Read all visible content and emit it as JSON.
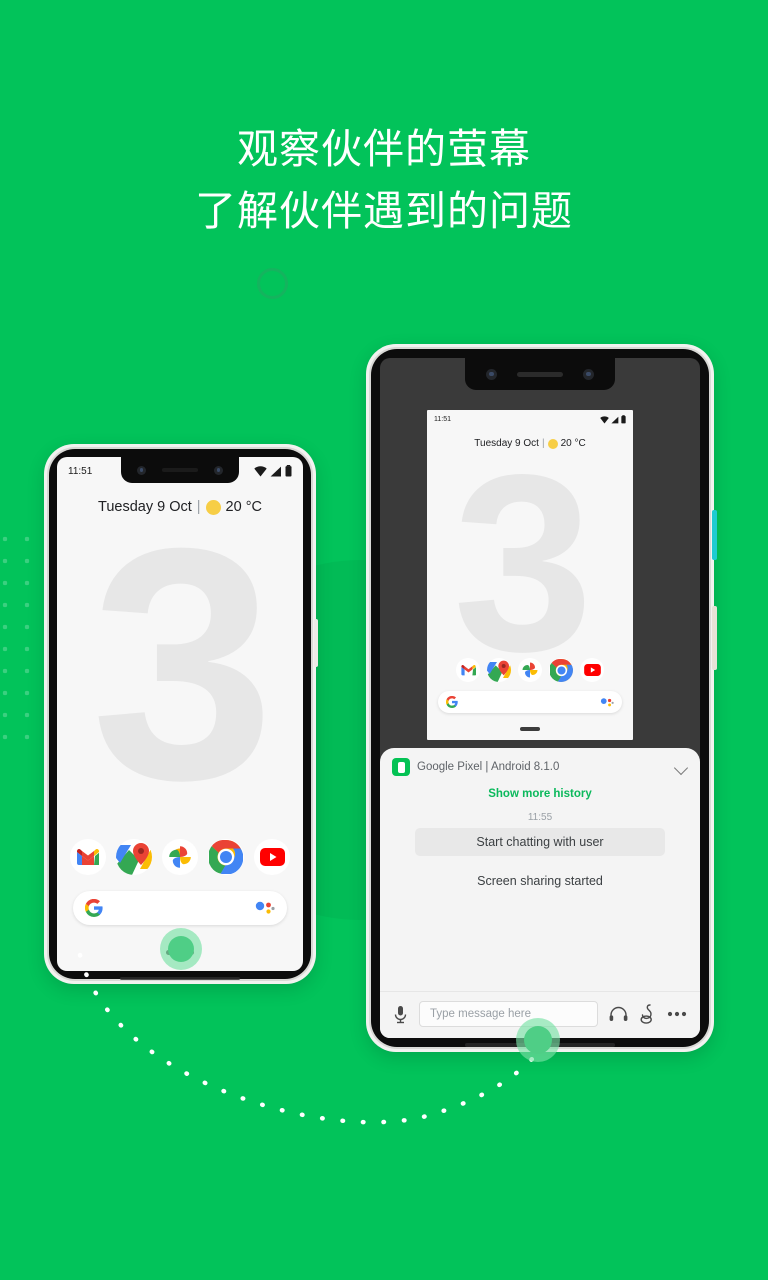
{
  "theme": {
    "background_green": "#02C35A",
    "accent_green": "#0BB95C",
    "marker_green": "#00A84A",
    "headline_color": "#FFFFFF",
    "phone_screen_bg": "#F7F7F7",
    "mirror_screen_bg": "#3A3A3A",
    "chat_panel_bg": "#F4F4F4"
  },
  "headline": {
    "line1": "观察伙伴的萤幕",
    "line2": "了解伙伴遇到的问题",
    "full": "观察伙伴的萤幕\n了解伙伴遇到的问题"
  },
  "android_home": {
    "status_time": "11:51",
    "status_icons": [
      "wifi-icon",
      "signal-icon",
      "battery-icon"
    ],
    "widget_date": "Tuesday 9 Oct",
    "widget_separator": "|",
    "widget_weather_icon": "sun-icon",
    "widget_temperature": "20 °C",
    "wallpaper_digit": "3",
    "dock_apps": [
      {
        "name": "gmail",
        "label": "Gmail"
      },
      {
        "name": "maps",
        "label": "Maps"
      },
      {
        "name": "photos",
        "label": "Photos"
      },
      {
        "name": "chrome",
        "label": "Chrome"
      },
      {
        "name": "youtube",
        "label": "YouTube"
      }
    ],
    "search_logo": "google-g-icon",
    "search_assistant": "google-assistant-icon"
  },
  "chat_panel": {
    "device_icon": "device-phone-icon",
    "device_title": "Google Pixel | Android 8.1.0",
    "collapse_icon": "chevron-down-icon",
    "show_more_label": "Show more history",
    "message_timestamp": "11:55",
    "chat_bubble": "Start chatting with user",
    "system_message": "Screen sharing started"
  },
  "input_bar": {
    "mic_icon": "microphone-icon",
    "message_placeholder": "Type message here",
    "message_value": "",
    "headset_icon": "headset-icon",
    "gesture_icon": "gesture-hand-icon",
    "more_icon": "more-options-icon"
  },
  "markers": {
    "left_phone_marker": "connection-marker-left",
    "right_phone_marker": "connection-marker-right",
    "path": "dotted-connection-path"
  }
}
